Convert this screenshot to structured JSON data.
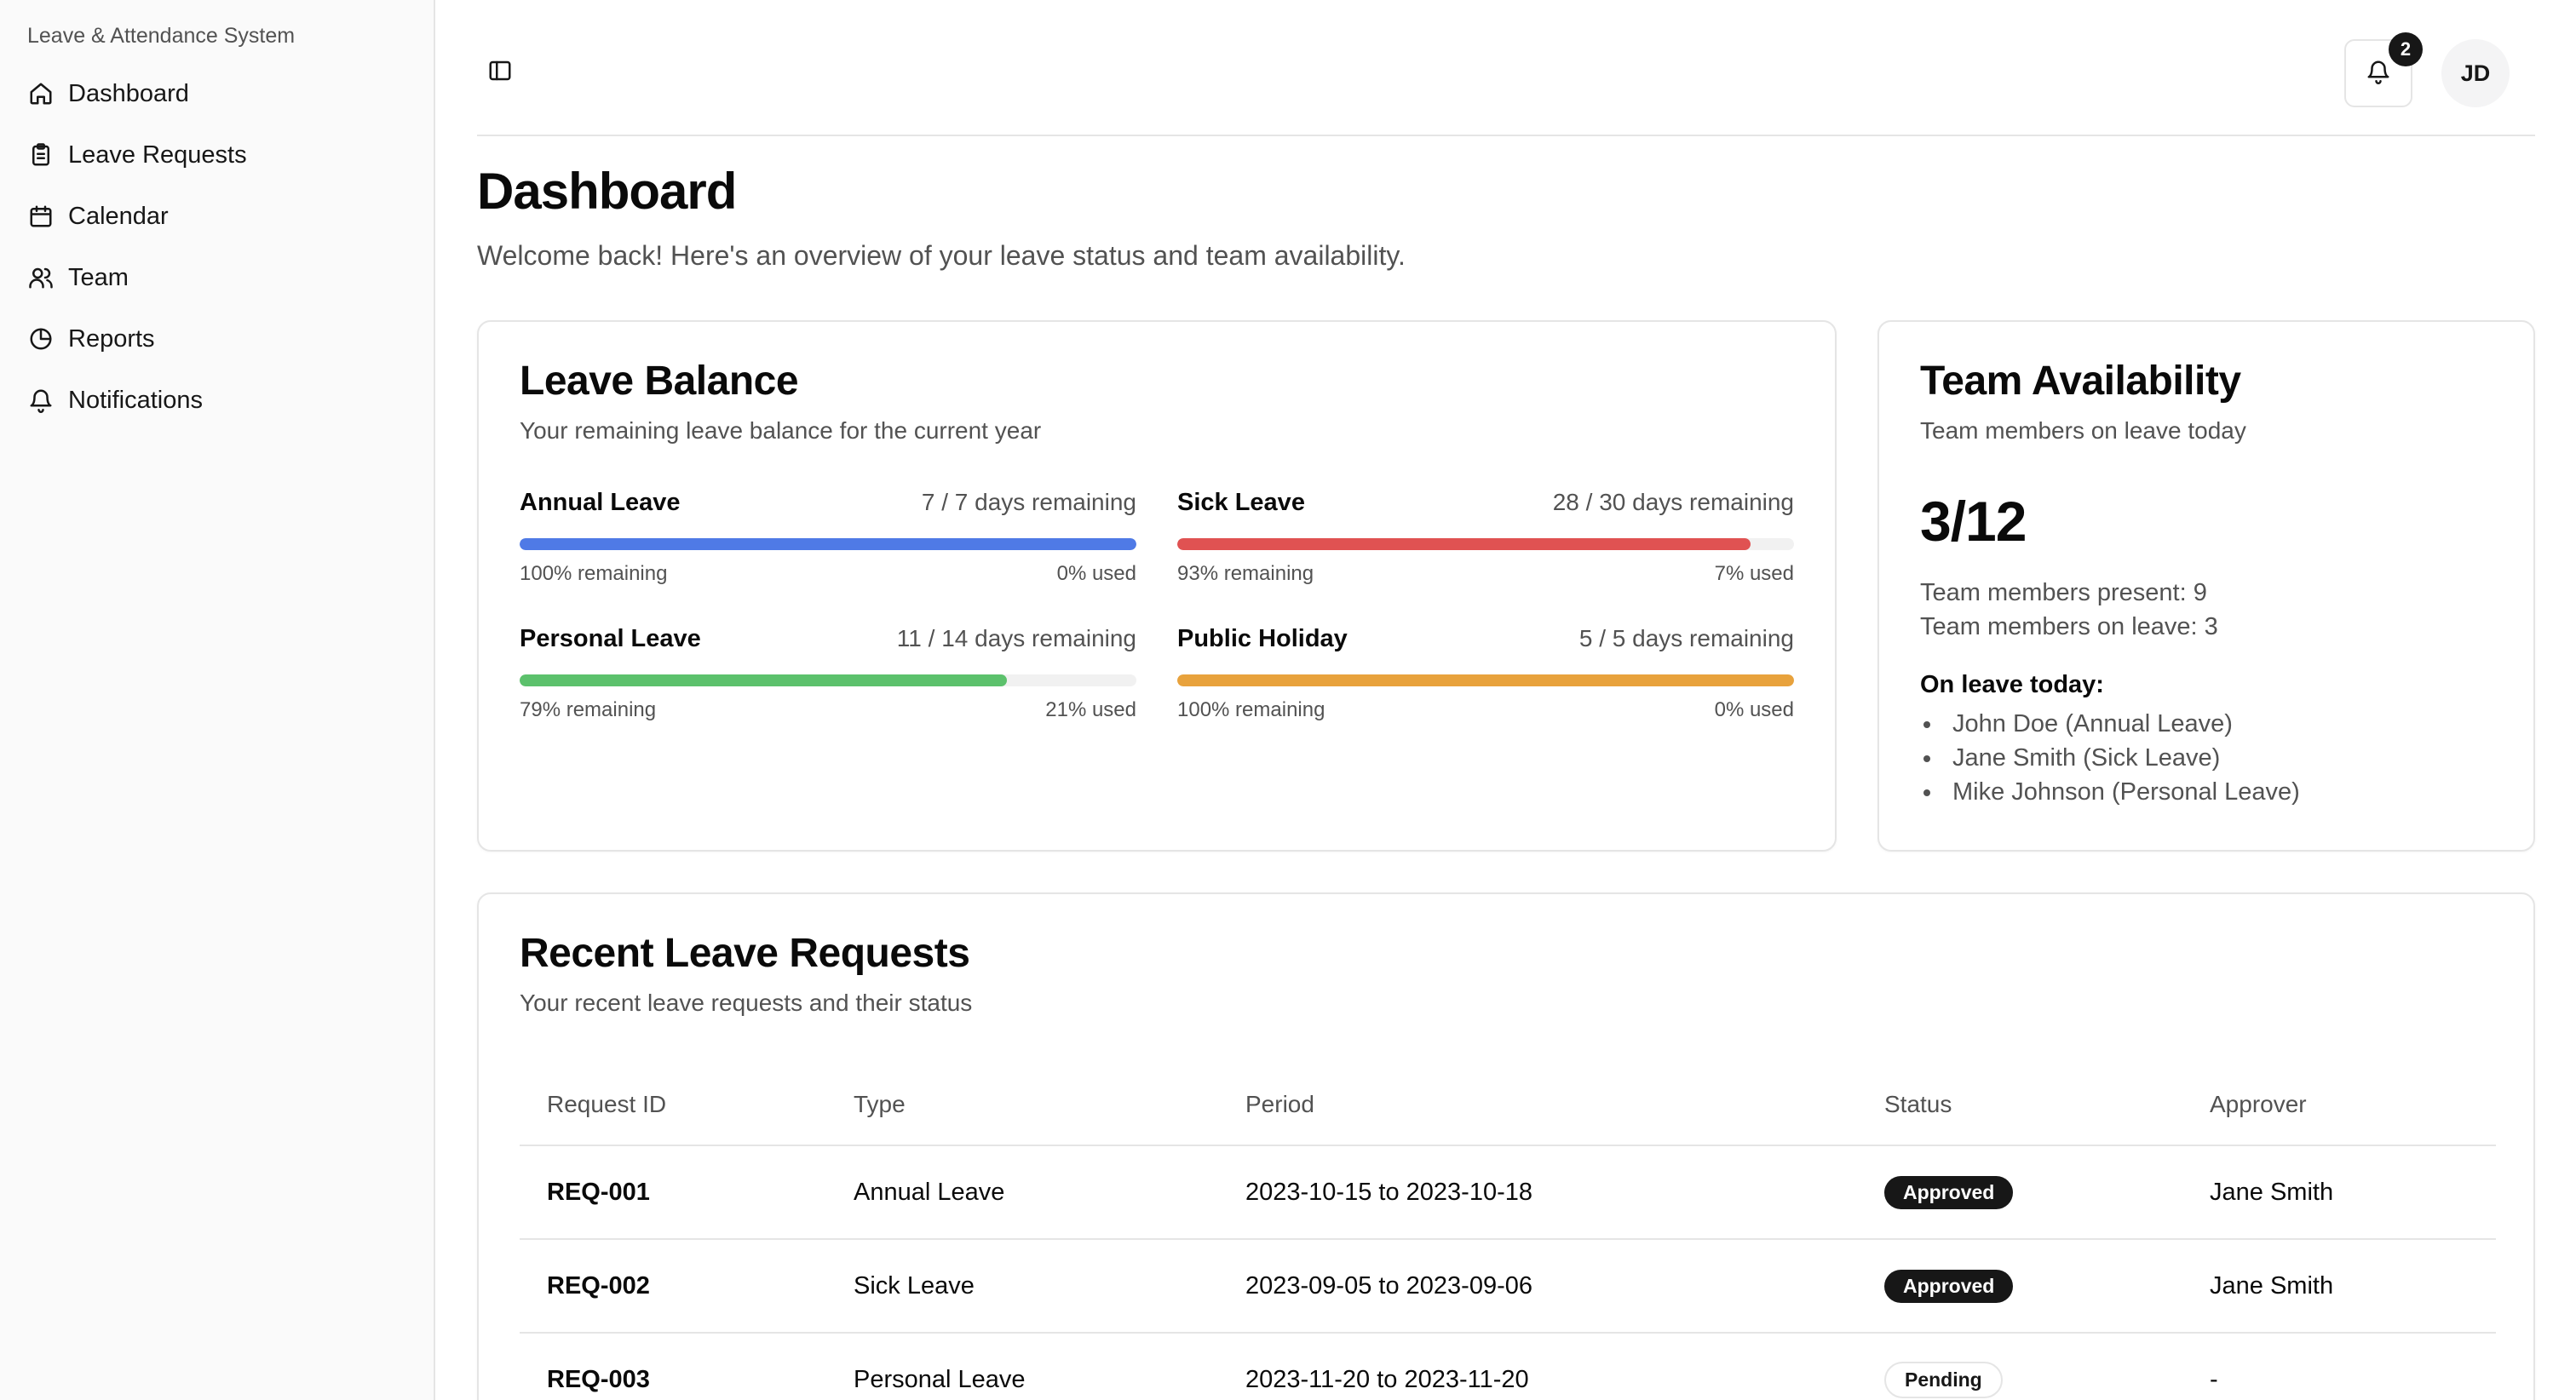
{
  "app": {
    "title": "Leave & Attendance System"
  },
  "sidebar": {
    "items": [
      {
        "label": "Dashboard",
        "icon": "home-icon"
      },
      {
        "label": "Leave Requests",
        "icon": "clipboard-icon"
      },
      {
        "label": "Calendar",
        "icon": "calendar-icon"
      },
      {
        "label": "Team",
        "icon": "users-icon"
      },
      {
        "label": "Reports",
        "icon": "pie-chart-icon"
      },
      {
        "label": "Notifications",
        "icon": "bell-icon"
      }
    ]
  },
  "header": {
    "notification_count": "2",
    "avatar_initials": "JD"
  },
  "page": {
    "title": "Dashboard",
    "subtitle": "Welcome back! Here's an overview of your leave status and team availability."
  },
  "leave_balance": {
    "title": "Leave Balance",
    "description": "Your remaining leave balance for the current year",
    "items": [
      {
        "name": "Annual Leave",
        "days": "7 / 7 days remaining",
        "remaining": "100% remaining",
        "used": "0% used",
        "fraction": 1.0,
        "color": "#4f7ae6"
      },
      {
        "name": "Sick Leave",
        "days": "28 / 30 days remaining",
        "remaining": "93% remaining",
        "used": "7% used",
        "fraction": 0.93,
        "color": "#e05252"
      },
      {
        "name": "Personal Leave",
        "days": "11 / 14 days remaining",
        "remaining": "79% remaining",
        "used": "21% used",
        "fraction": 0.79,
        "color": "#5cc16c"
      },
      {
        "name": "Public Holiday",
        "days": "5 / 5 days remaining",
        "remaining": "100% remaining",
        "used": "0% used",
        "fraction": 1.0,
        "color": "#e8a23c"
      }
    ]
  },
  "team_availability": {
    "title": "Team Availability",
    "description": "Team members on leave today",
    "ratio": "3/12",
    "present": "Team members present: 9",
    "on_leave": "Team members on leave: 3",
    "on_leave_title": "On leave today:",
    "members": [
      "John Doe (Annual Leave)",
      "Jane Smith (Sick Leave)",
      "Mike Johnson (Personal Leave)"
    ]
  },
  "recent_requests": {
    "title": "Recent Leave Requests",
    "description": "Your recent leave requests and their status",
    "columns": [
      "Request ID",
      "Type",
      "Period",
      "Status",
      "Approver"
    ],
    "rows": [
      {
        "id": "REQ-001",
        "type": "Annual Leave",
        "period": "2023-10-15 to 2023-10-18",
        "status": "Approved",
        "status_kind": "approved",
        "approver": "Jane Smith"
      },
      {
        "id": "REQ-002",
        "type": "Sick Leave",
        "period": "2023-09-05 to 2023-09-06",
        "status": "Approved",
        "status_kind": "approved",
        "approver": "Jane Smith"
      },
      {
        "id": "REQ-003",
        "type": "Personal Leave",
        "period": "2023-11-20 to 2023-11-20",
        "status": "Pending",
        "status_kind": "pending",
        "approver": "-"
      }
    ]
  }
}
